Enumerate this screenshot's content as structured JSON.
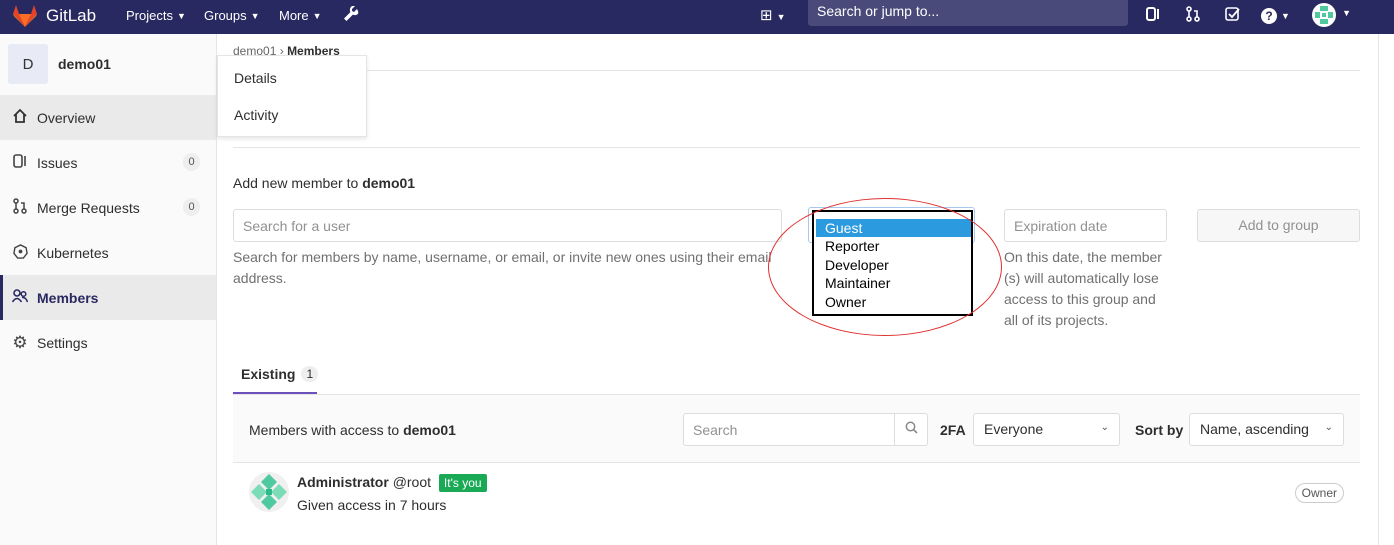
{
  "navbar": {
    "brand": "GitLab",
    "menus": [
      {
        "label": "Projects"
      },
      {
        "label": "Groups"
      },
      {
        "label": "More"
      }
    ],
    "search_placeholder": "Search or jump to...",
    "icons": [
      "plus-square-icon",
      "sidebar-icon",
      "merge-request-icon",
      "todo-check-icon",
      "help-icon",
      "user-avatar"
    ]
  },
  "sidebar": {
    "project_initial": "D",
    "project_name": "demo01",
    "items": [
      {
        "label": "Overview",
        "icon": "home-icon"
      },
      {
        "label": "Issues",
        "icon": "issues-icon",
        "count": "0"
      },
      {
        "label": "Merge Requests",
        "icon": "merge-request-icon",
        "count": "0"
      },
      {
        "label": "Kubernetes",
        "icon": "kubernetes-icon"
      },
      {
        "label": "Members",
        "icon": "members-icon"
      },
      {
        "label": "Settings",
        "icon": "gear-icon"
      }
    ]
  },
  "flyout": {
    "items": [
      "Details",
      "Activity"
    ]
  },
  "breadcrumb": {
    "parent": "demo01",
    "current": "Members"
  },
  "add_member": {
    "label_prefix": "Add new member to",
    "group_name": "demo01",
    "user_search_placeholder": "Search for a user",
    "user_search_help": "Search for members by name, username, or email, or invite new ones using their email address.",
    "roles": [
      "Guest",
      "Reporter",
      "Developer",
      "Maintainer",
      "Owner"
    ],
    "selected_role": "Guest",
    "expiration_placeholder": "Expiration date",
    "expiration_help": "On this date, the member (s) will automatically lose access to this group and all of its projects.",
    "add_button": "Add to group"
  },
  "tabs": [
    {
      "label": "Existing",
      "count": "1"
    }
  ],
  "members_panel": {
    "title_prefix": "Members with access to",
    "group_name": "demo01",
    "search_placeholder": "Search",
    "twofa_label": "2FA",
    "twofa_value": "Everyone",
    "sort_label": "Sort by",
    "sort_value": "Name, ascending"
  },
  "members": [
    {
      "name": "Administrator",
      "username": "@root",
      "badge": "It's you",
      "access": "Given access in 7 hours",
      "role": "Owner"
    }
  ],
  "colors": {
    "navbar": "#292961",
    "selected_role": "#2b9adf",
    "annotation": "#e03030",
    "badge_green": "#1aaa55"
  }
}
